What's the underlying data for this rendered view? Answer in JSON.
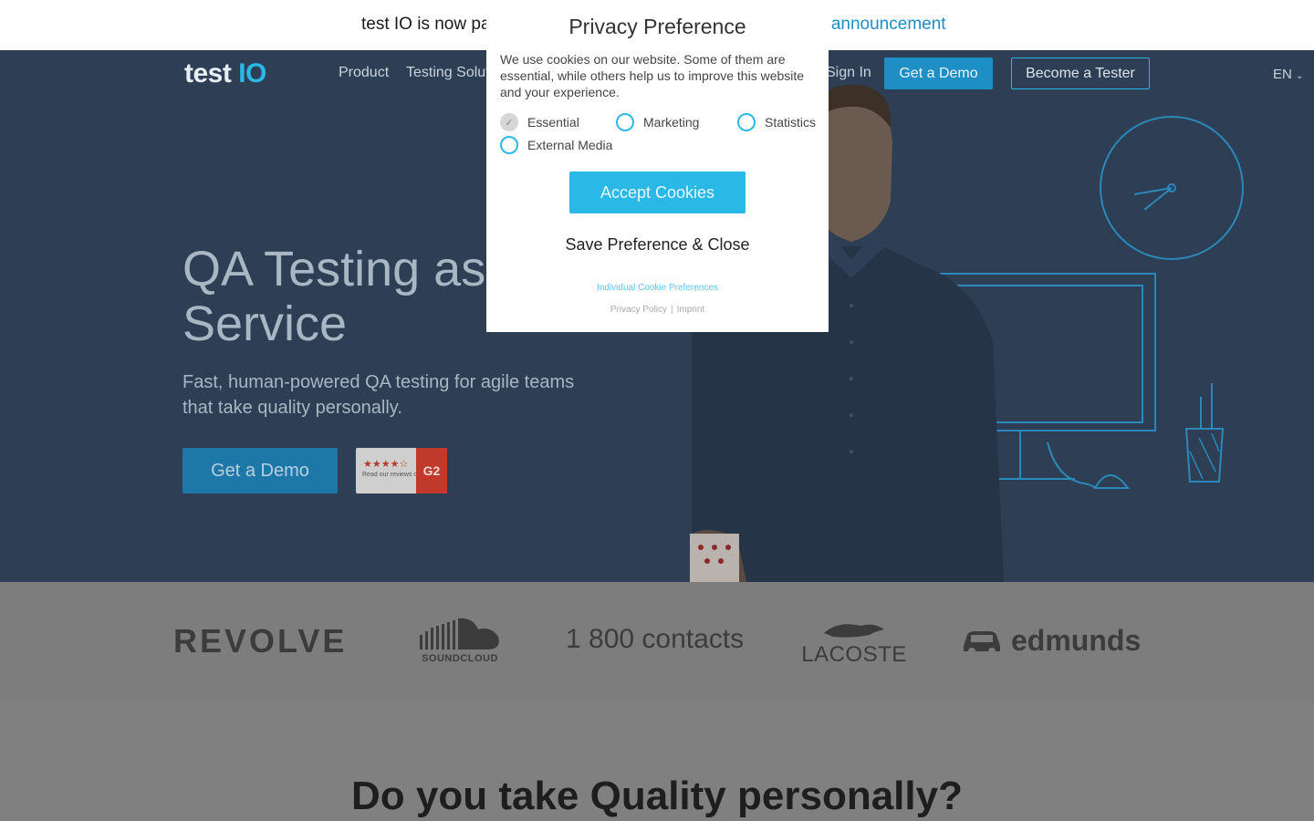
{
  "announcement": {
    "text": "test IO is now pa",
    "link": "e announcement"
  },
  "nav": {
    "logo_main": "test ",
    "logo_accent": "IO",
    "product": "Product",
    "testing": "Testing Solut",
    "sign_in": "Sign In",
    "get_demo": "Get a Demo",
    "become_tester": "Become a Tester",
    "language": "EN"
  },
  "hero": {
    "title": "QA Testing as a Service",
    "subtitle": "Fast, human-powered QA testing for agile teams that take quality personally.",
    "cta": "Get a Demo",
    "badge_stars": "★★★★☆",
    "badge_text": "Read our reviews on",
    "badge_g2": "G2"
  },
  "logos": {
    "revolve": "REVOLVE",
    "soundcloud": "SOUNDCLOUD",
    "contacts": "1 800 contacts",
    "lacoste": "LACOSTE",
    "edmunds": "edmunds"
  },
  "section": {
    "title": "Do you take Quality personally?"
  },
  "modal": {
    "title": "Privacy Preference",
    "description": "We use cookies on our website. Some of them are essential, while others help us to improve this website and your experience.",
    "options": {
      "essential": "Essential",
      "marketing": "Marketing",
      "statistics": "Statistics",
      "external_media": "External Media"
    },
    "accept": "Accept Cookies",
    "save": "Save Preference & Close",
    "individual": "Individual Cookie Preferences",
    "privacy_policy": "Privacy Policy",
    "separator": "|",
    "imprint": "Imprint"
  },
  "colors": {
    "hero_bg": "#2d3e55",
    "accent": "#2ab8e6",
    "button_blue": "#1d8fc4"
  }
}
